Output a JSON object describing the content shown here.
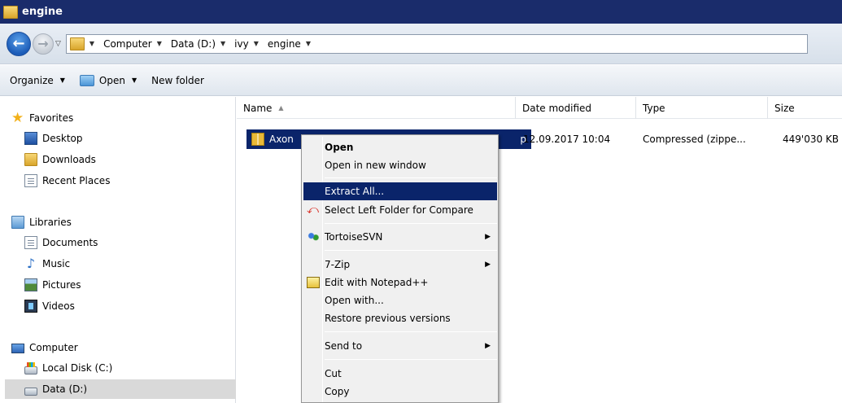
{
  "window": {
    "title": "engine"
  },
  "address": {
    "crumbs": [
      "Computer",
      "Data (D:)",
      "ivy",
      "engine"
    ]
  },
  "toolbar": {
    "organize": "Organize",
    "open": "Open",
    "new_folder": "New folder"
  },
  "nav": {
    "favorites": "Favorites",
    "desktop": "Desktop",
    "downloads": "Downloads",
    "recent": "Recent Places",
    "libraries": "Libraries",
    "documents": "Documents",
    "music": "Music",
    "pictures": "Pictures",
    "videos": "Videos",
    "computer": "Computer",
    "local_disk": "Local Disk (C:)",
    "data": "Data (D:)"
  },
  "columns": {
    "name": "Name",
    "date": "Date modified",
    "type": "Type",
    "size": "Size"
  },
  "file": {
    "name_start": "Axon",
    "name_end": "p",
    "date": "12.09.2017 10:04",
    "type": "Compressed (zippe...",
    "size": "449'030 KB"
  },
  "context_menu": {
    "open": "Open",
    "open_new_window": "Open in new window",
    "extract_all": "Extract All...",
    "select_left": "Select Left Folder for Compare",
    "tortoise": "TortoiseSVN",
    "sevenzip": "7-Zip",
    "notepad": "Edit with Notepad++",
    "open_with": "Open with...",
    "restore": "Restore previous versions",
    "send_to": "Send to",
    "cut": "Cut",
    "copy": "Copy"
  },
  "colors": {
    "titlebar": "#1a2c6b",
    "selection": "#0a246a",
    "menu_bg": "#f0f0f0"
  }
}
